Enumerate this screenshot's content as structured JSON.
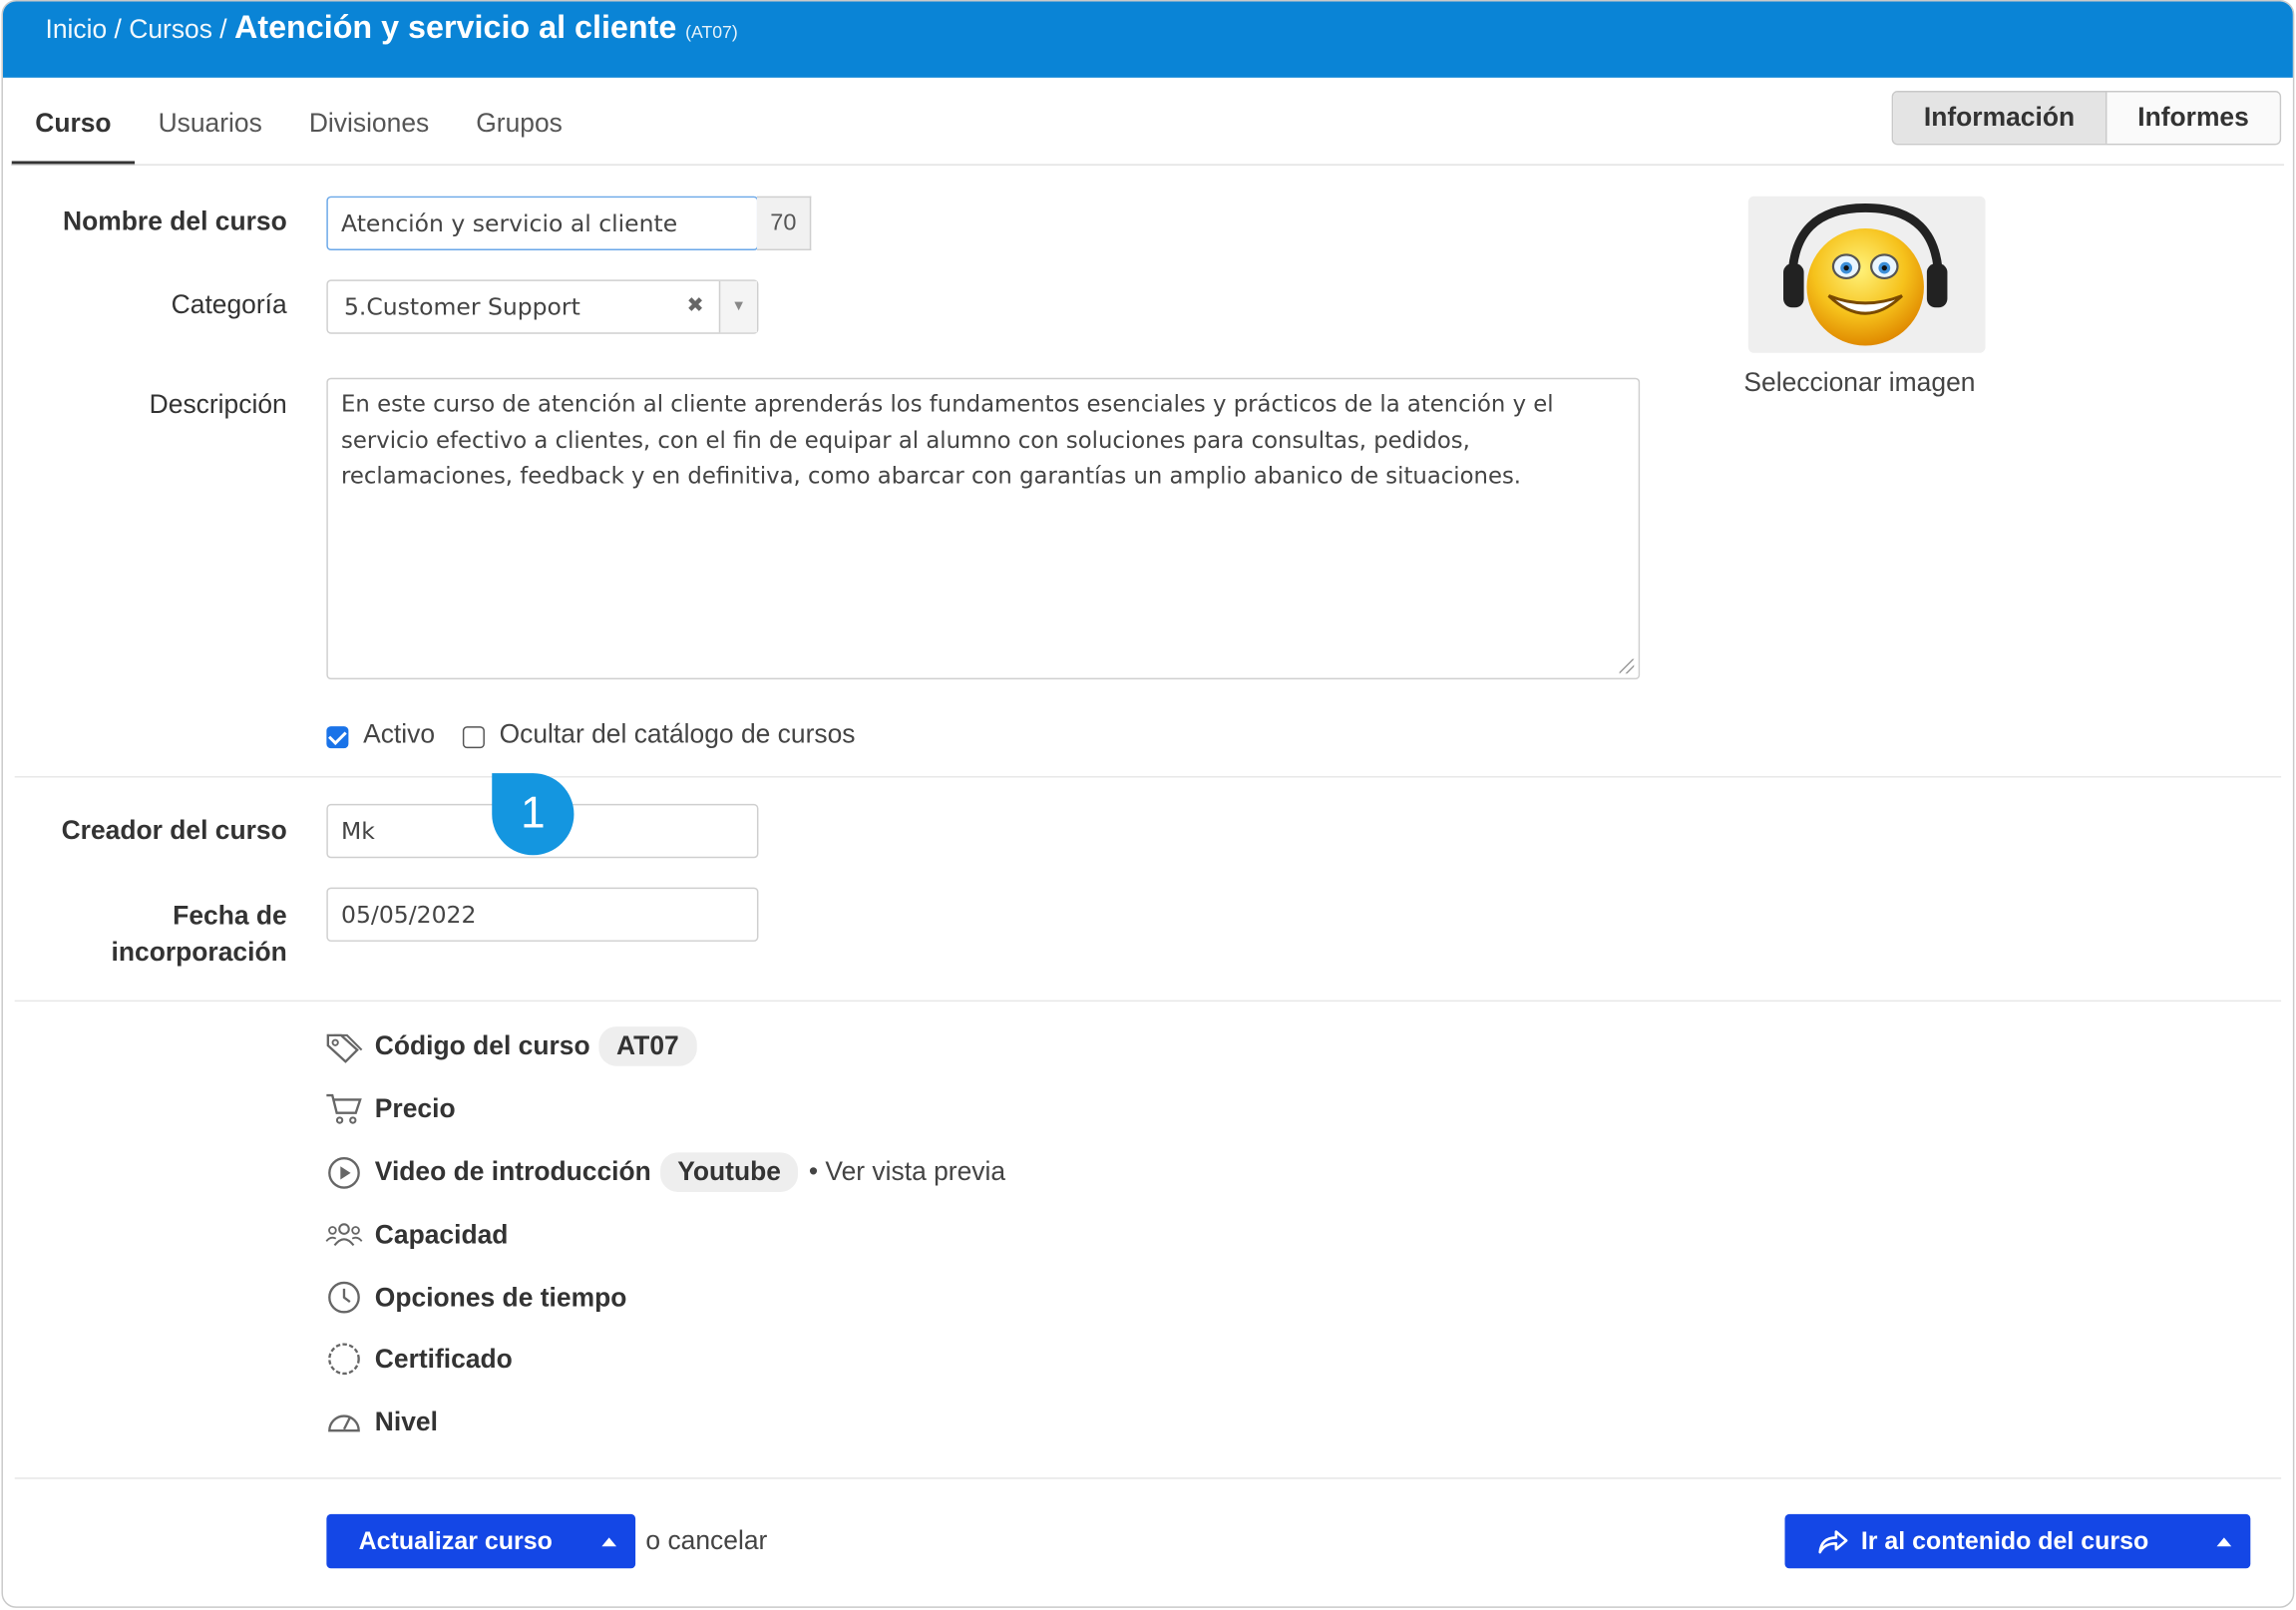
{
  "breadcrumb": {
    "home": "Inicio",
    "section": "Cursos",
    "separator": "/",
    "title": "Atención y servicio al cliente",
    "code": "(AT07)"
  },
  "tabs": [
    {
      "label": "Curso",
      "active": true
    },
    {
      "label": "Usuarios",
      "active": false
    },
    {
      "label": "Divisiones",
      "active": false
    },
    {
      "label": "Grupos",
      "active": false
    }
  ],
  "view_toggle": {
    "info": "Información",
    "reports": "Informes",
    "selected": "Información"
  },
  "form": {
    "name_label": "Nombre del curso",
    "name_value": "Atención y servicio al cliente",
    "name_counter": "70",
    "category_label": "Categoría",
    "category_value": "5.Customer Support",
    "description_label": "Descripción",
    "description_value": "En este curso de atención al cliente aprenderás los fundamentos esenciales y prácticos de la atención y el servicio efectivo a clientes, con el fin de equipar al alumno con soluciones para consultas, pedidos, reclamaciones, feedback y en definitiva, como abarcar con garantías un amplio abanico de situaciones.",
    "active_label": "Activo",
    "active_checked": true,
    "hide_label": "Ocultar del catálogo de cursos",
    "hide_checked": false,
    "creator_label": "Creador del curso",
    "creator_value": "Mk",
    "date_label_line1": "Fecha de",
    "date_label_line2": "incorporación",
    "date_value": "05/05/2022"
  },
  "callout": {
    "number": "1"
  },
  "image": {
    "caption": "Seleccionar imagen",
    "icon": "smiley-headphones-image"
  },
  "meta": {
    "code_label": "Código del curso",
    "code_value": "AT07",
    "price_label": "Precio",
    "video_label": "Video de introducción",
    "video_value": "Youtube",
    "video_preview": "• Ver vista previa",
    "capacity_label": "Capacidad",
    "time_label": "Opciones de tiempo",
    "certificate_label": "Certificado",
    "level_label": "Nivel"
  },
  "footer": {
    "update_label": "Actualizar curso",
    "or_text": "o",
    "cancel_label": "cancelar",
    "go_content_label": "Ir al contenido del curso"
  },
  "colors": {
    "topbar": "#0a84d6",
    "primary_button": "#1447e6",
    "callout": "#1496e0",
    "checkbox": "#1a73e8"
  }
}
